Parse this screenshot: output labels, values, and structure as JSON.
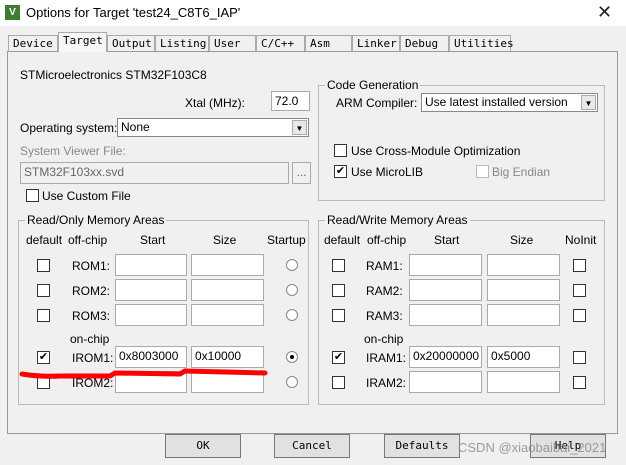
{
  "window": {
    "title": "Options for Target 'test24_C8T6_IAP'",
    "close": "✕",
    "icon": "V"
  },
  "tabs": [
    "Device",
    "Target",
    "Output",
    "Listing",
    "User",
    "C/C++",
    "Asm",
    "Linker",
    "Debug",
    "Utilities"
  ],
  "device": "STMicroelectronics STM32F103C8",
  "xtal": {
    "label": "Xtal (MHz):",
    "value": "72.0"
  },
  "os": {
    "label": "Operating system:",
    "value": "None"
  },
  "svf": {
    "label": "System Viewer File:",
    "value": "STM32F103xx.svd",
    "browse": "..."
  },
  "custom_file": {
    "label": "Use Custom File",
    "checked": false
  },
  "codegen": {
    "title": "Code Generation",
    "compiler_label": "ARM Compiler:",
    "compiler_value": "Use latest installed version",
    "cross_module": {
      "label": "Use Cross-Module Optimization",
      "checked": false
    },
    "microlib": {
      "label": "Use MicroLIB",
      "checked": true
    },
    "big_endian": {
      "label": "Big Endian",
      "checked": false
    }
  },
  "rom": {
    "title": "Read/Only Memory Areas",
    "headers": [
      "default",
      "off-chip",
      "Start",
      "Size",
      "Startup"
    ],
    "onchip": "on-chip",
    "rows": [
      {
        "name": "ROM1:",
        "start": "",
        "size": "",
        "default": false,
        "startup": false
      },
      {
        "name": "ROM2:",
        "start": "",
        "size": "",
        "default": false,
        "startup": false
      },
      {
        "name": "ROM3:",
        "start": "",
        "size": "",
        "default": false,
        "startup": false
      },
      {
        "name": "IROM1:",
        "start": "0x8003000",
        "size": "0x10000",
        "default": true,
        "startup": true
      },
      {
        "name": "IROM2:",
        "start": "",
        "size": "",
        "default": false,
        "startup": false
      }
    ]
  },
  "ram": {
    "title": "Read/Write Memory Areas",
    "headers": [
      "default",
      "off-chip",
      "Start",
      "Size",
      "NoInit"
    ],
    "onchip": "on-chip",
    "rows": [
      {
        "name": "RAM1:",
        "start": "",
        "size": "",
        "default": false,
        "noinit": false
      },
      {
        "name": "RAM2:",
        "start": "",
        "size": "",
        "default": false,
        "noinit": false
      },
      {
        "name": "RAM3:",
        "start": "",
        "size": "",
        "default": false,
        "noinit": false
      },
      {
        "name": "IRAM1:",
        "start": "0x20000000",
        "size": "0x5000",
        "default": true,
        "noinit": false
      },
      {
        "name": "IRAM2:",
        "start": "",
        "size": "",
        "default": false,
        "noinit": false
      }
    ]
  },
  "buttons": {
    "ok": "OK",
    "cancel": "Cancel",
    "defaults": "Defaults",
    "help": "Help"
  },
  "watermark": "CSDN @xiaobaibai_2021",
  "annotation_color": "#ff0000"
}
